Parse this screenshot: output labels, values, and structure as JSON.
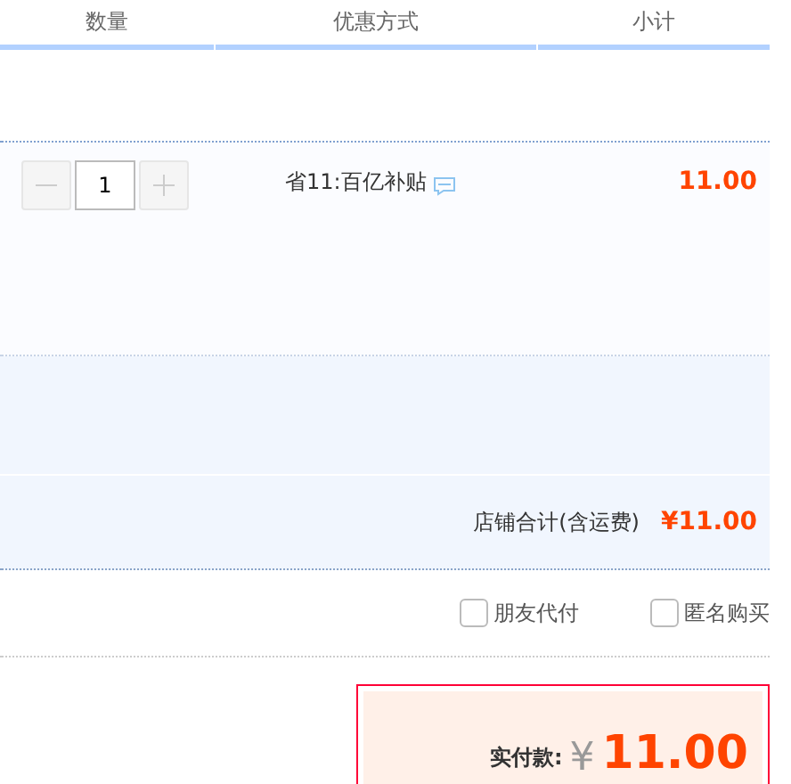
{
  "columns": [
    {
      "label": "数量"
    },
    {
      "label": "优惠方式"
    },
    {
      "label": "小计"
    }
  ],
  "item": {
    "quantity": "1",
    "discount": "省11:百亿补贴",
    "subtotal": "11.00"
  },
  "shop_total": {
    "label": "店铺合计(含运费)",
    "amount": "¥11.00"
  },
  "options": [
    {
      "label": "朋友代付",
      "checked": false
    },
    {
      "label": "匿名购买",
      "checked": false
    }
  ],
  "payment": {
    "label": "实付款:",
    "currency": "¥",
    "amount": "11.00"
  }
}
